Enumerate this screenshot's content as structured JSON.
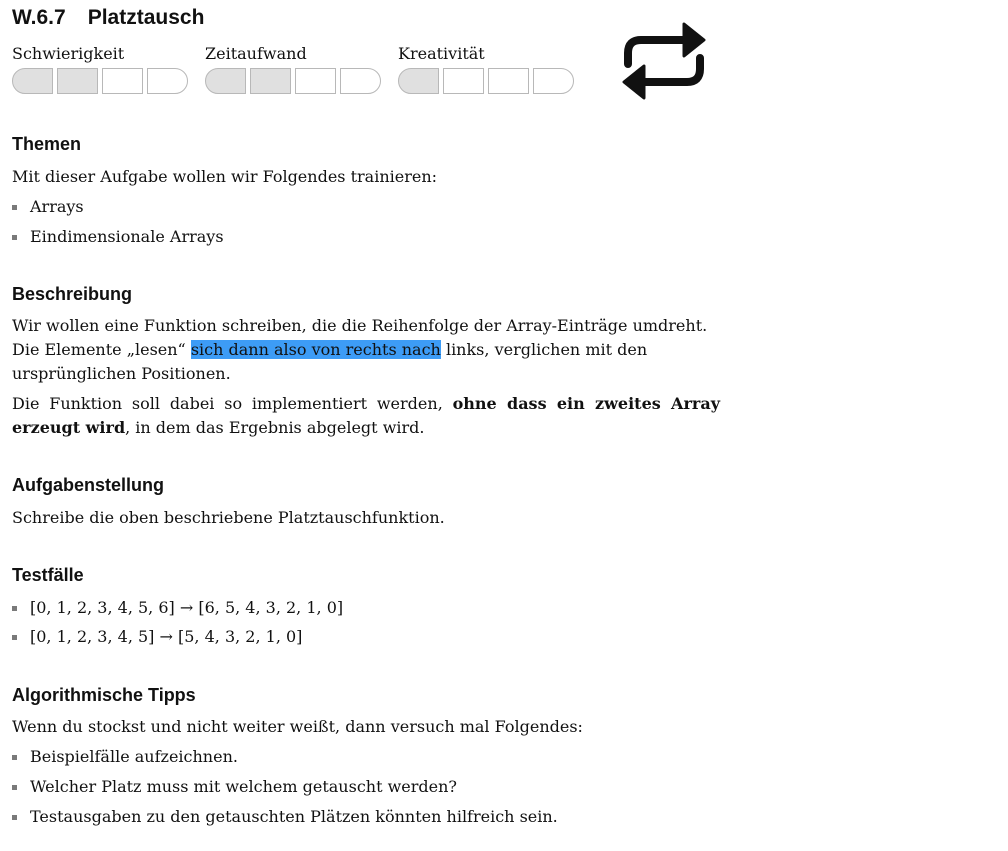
{
  "header": {
    "number": "W.6.7",
    "title": "Platztausch",
    "ratings": [
      {
        "label": "Schwierigkeit",
        "level": 2,
        "max": 4
      },
      {
        "label": "Zeitaufwand",
        "level": 2,
        "max": 4
      },
      {
        "label": "Kreativität",
        "level": 1,
        "max": 4
      }
    ],
    "icon": "repeat-icon"
  },
  "themen": {
    "heading": "Themen",
    "intro": "Mit dieser Aufgabe wollen wir Folgendes trainieren:",
    "items": [
      "Arrays",
      "Eindimensionale Arrays"
    ]
  },
  "beschreibung": {
    "heading": "Beschreibung",
    "p1_a": "Wir wollen eine Funktion schreiben, die die Reihenfolge der Array-Einträge umdreht. Die Elemente „lesen“ ",
    "p1_highlight": "sich dann also von rechts nach",
    "p1_b": " links, verglichen mit den ursprünglichen Positionen.",
    "p2_a": "Die Funktion soll dabei so implementiert werden, ",
    "p2_bold": "ohne dass ein zweites Array erzeugt wird",
    "p2_b": ", in dem das Ergebnis abgelegt wird."
  },
  "aufgabe": {
    "heading": "Aufgabenstellung",
    "text": "Schreibe die oben beschriebene Platztauschfunktion."
  },
  "testfaelle": {
    "heading": "Testfälle",
    "items": [
      "[0, 1, 2, 3, 4, 5, 6] → [6, 5, 4, 3, 2, 1, 0]",
      "[0, 1, 2, 3, 4, 5] → [5, 4, 3, 2, 1, 0]"
    ]
  },
  "tipps": {
    "heading": "Algorithmische Tipps",
    "intro": "Wenn du stockst und nicht weiter weißt, dann versuch mal Folgendes:",
    "items": [
      "Beispielfälle aufzeichnen.",
      "Welcher Platz muss mit welchem getauscht werden?",
      "Testausgaben zu den getauschten Plätzen könnten hilfreich sein."
    ]
  },
  "colors": {
    "highlight": "#3d9cf6",
    "box_fill": "#e0e0e0",
    "bullet": "#7a7a7a"
  }
}
